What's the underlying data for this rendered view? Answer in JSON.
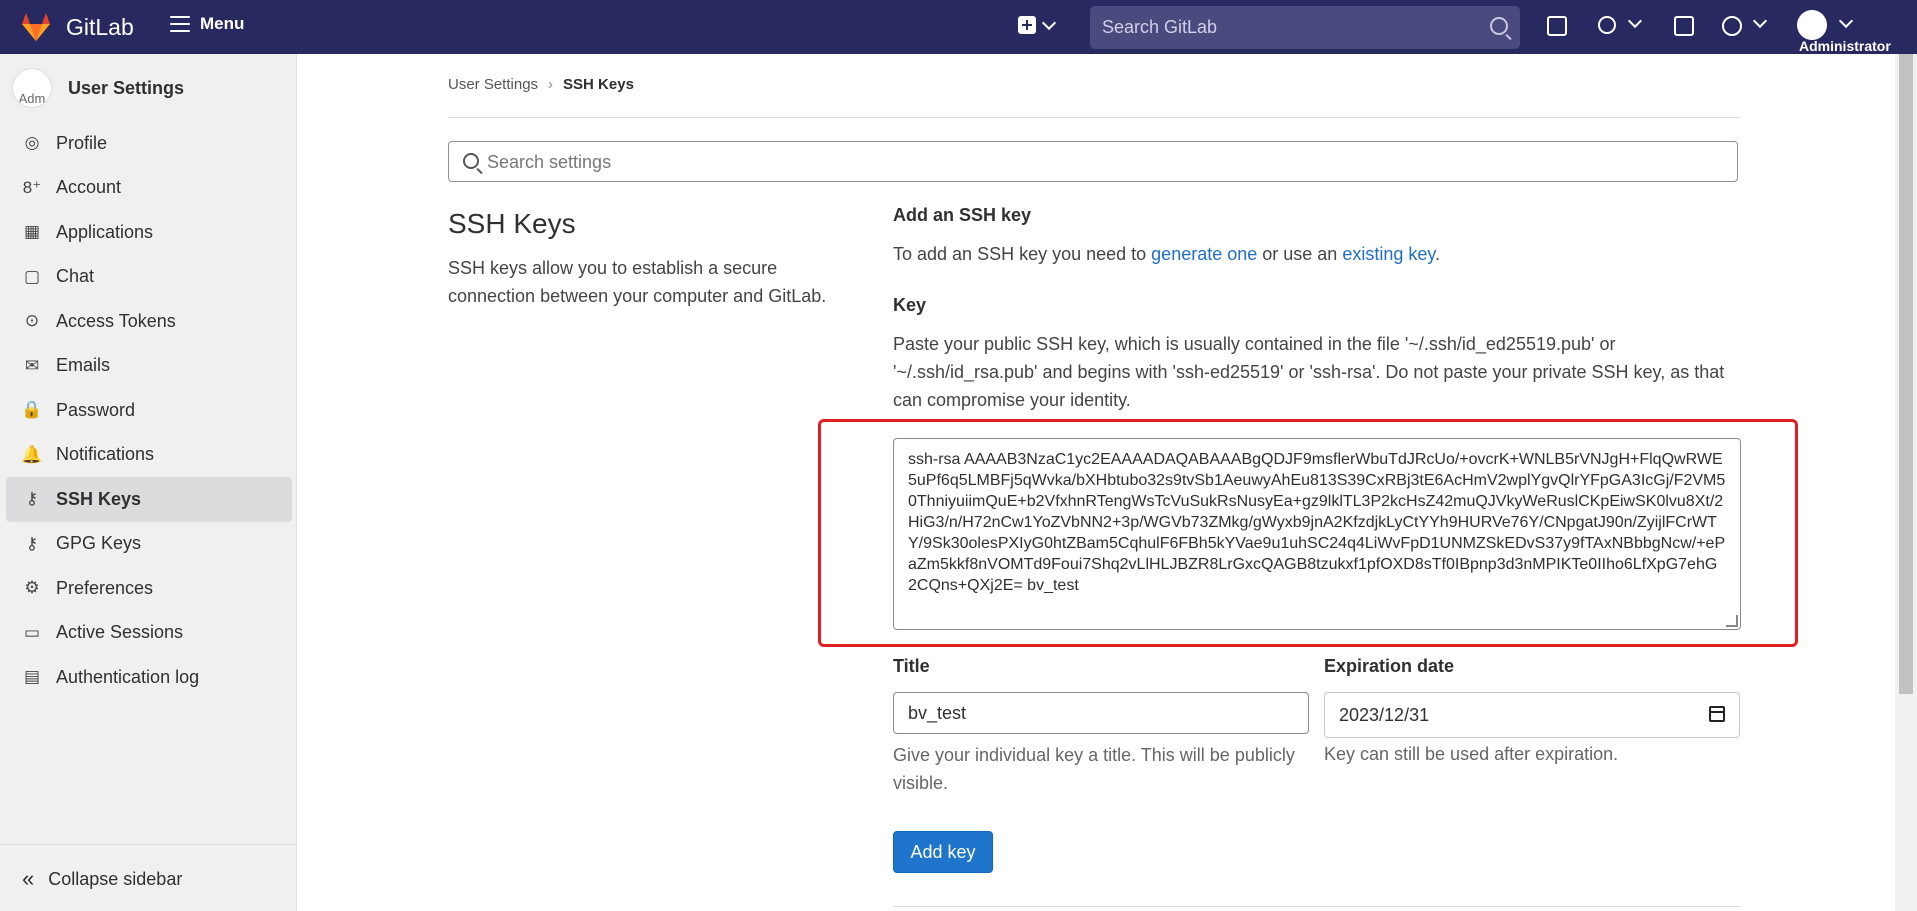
{
  "topbar": {
    "brand": "GitLab",
    "menu_label": "Menu",
    "search_placeholder": "Search GitLab",
    "user_label": "Administrator"
  },
  "sidebar": {
    "avatar_text": "Adm",
    "title": "User Settings",
    "items": [
      {
        "label": "Profile",
        "icon": "profile-icon",
        "glyph": "◎"
      },
      {
        "label": "Account",
        "icon": "account-icon",
        "glyph": "8⁺"
      },
      {
        "label": "Applications",
        "icon": "applications-icon",
        "glyph": "▦"
      },
      {
        "label": "Chat",
        "icon": "chat-icon",
        "glyph": "▢"
      },
      {
        "label": "Access Tokens",
        "icon": "token-icon",
        "glyph": "⊙"
      },
      {
        "label": "Emails",
        "icon": "email-icon",
        "glyph": "✉"
      },
      {
        "label": "Password",
        "icon": "lock-icon",
        "glyph": "🔒"
      },
      {
        "label": "Notifications",
        "icon": "bell-icon",
        "glyph": "🔔"
      },
      {
        "label": "SSH Keys",
        "icon": "key-icon",
        "glyph": "⚷"
      },
      {
        "label": "GPG Keys",
        "icon": "gpg-key-icon",
        "glyph": "⚷"
      },
      {
        "label": "Preferences",
        "icon": "preferences-icon",
        "glyph": "⚙"
      },
      {
        "label": "Active Sessions",
        "icon": "monitor-icon",
        "glyph": "▭"
      },
      {
        "label": "Authentication log",
        "icon": "log-icon",
        "glyph": "▤"
      }
    ],
    "active_index": 8,
    "collapse_label": "Collapse sidebar"
  },
  "breadcrumb": {
    "parent": "User Settings",
    "separator": "›",
    "current": "SSH Keys"
  },
  "settings_search": {
    "placeholder": "Search settings"
  },
  "section": {
    "title": "SSH Keys",
    "description": "SSH keys allow you to establish a secure connection between your computer and GitLab."
  },
  "form": {
    "add_title": "Add an SSH key",
    "intro_prefix": "To add an SSH key you need to ",
    "generate_link": "generate one",
    "intro_middle": " or use an ",
    "existing_link": "existing key",
    "intro_suffix": ".",
    "key_label": "Key",
    "key_help": "Paste your public SSH key, which is usually contained in the file '~/.ssh/id_ed25519.pub' or '~/.ssh/id_rsa.pub' and begins with 'ssh-ed25519' or 'ssh-rsa'. Do not paste your private SSH key, as that can compromise your identity.",
    "key_value": "ssh-rsa AAAAB3NzaC1yc2EAAAADAQABAAABgQDJF9msflerWbuTdJRcUo/+ovcrK+WNLB5rVNJgH+FlqQwRWE5uPf6q5LMBFj5qWvka/bXHbtubo32s9tvSb1AeuwyAhEu813S39CxRBj3tE6AcHmV2wplYgvQlrYFpGA3IcGj/F2VM50ThniyuiimQuE+b2VfxhnRTengWsTcVuSukRsNusyEa+gz9lklTL3P2kcHsZ42muQJVkyWeRuslCKpEiwSK0lvu8Xt/2HiG3/n/H72nCw1YoZVbNN2+3p/WGVb73ZMkg/gWyxb9jnA2KfzdjkLyCtYYh9HURVe76Y/CNpgatJ90n/ZyijlFCrWTY/9Sk30olesPXIyG0htZBam5CqhulF6FBh5kYVae9u1uhSC24q4LiWvFpD1UNMZSkEDvS37y9fTAxNBbbgNcw/+ePaZm5kkf8nVOMTd9Foui7Shq2vLlHLJBZR8LrGxcQAGB8tzukxf1pfOXD8sTf0IBpnp3d3nMPIKTe0IIho6LfXpG7ehG2CQns+QXj2E= bv_test",
    "title_label": "Title",
    "title_value": "bv_test",
    "title_help": "Give your individual key a title. This will be publicly visible.",
    "expiration_label": "Expiration date",
    "expiration_value": "2023/12/31",
    "expiration_help": "Key can still be used after expiration.",
    "submit_label": "Add key"
  },
  "colors": {
    "navbar": "#292961",
    "highlight_box": "#e02020",
    "primary_button": "#1f75cb",
    "link": "#1f6ec7"
  }
}
